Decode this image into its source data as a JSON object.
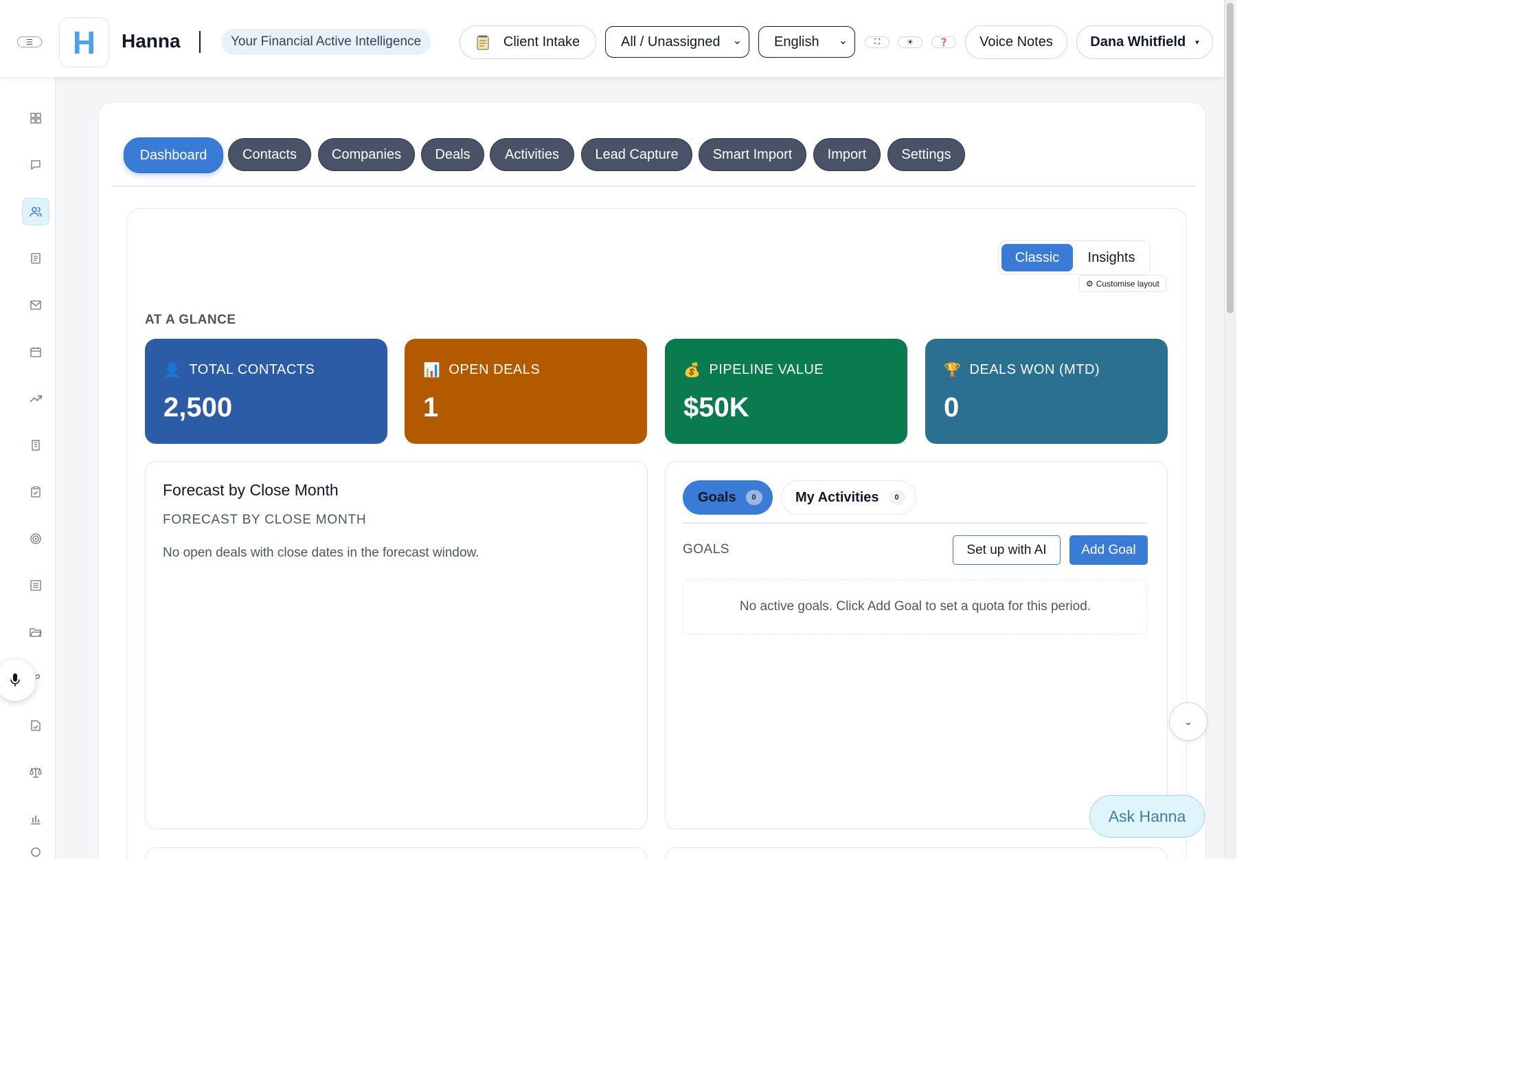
{
  "header": {
    "logo_letter": "H",
    "app_name": "Hanna",
    "tagline": "Your Financial Active Intelligence",
    "client_intake_label": "Client Intake",
    "assignment_filter": "All / Unassigned",
    "language": "English",
    "voice_notes_label": "Voice Notes",
    "user_name": "Dana Whitfield"
  },
  "tabs": [
    {
      "label": "Dashboard",
      "active": true
    },
    {
      "label": "Contacts"
    },
    {
      "label": "Companies"
    },
    {
      "label": "Deals"
    },
    {
      "label": "Activities"
    },
    {
      "label": "Lead Capture"
    },
    {
      "label": "Smart Import"
    },
    {
      "label": "Import"
    },
    {
      "label": "Settings"
    }
  ],
  "view_switch": {
    "classic": "Classic",
    "insights": "Insights",
    "customise": "Customise layout"
  },
  "at_a_glance": {
    "label": "AT A GLANCE",
    "kpis": [
      {
        "label": "TOTAL CONTACTS",
        "value": "2,500",
        "icon": "person-icon",
        "color": "#2d5ca6"
      },
      {
        "label": "OPEN DEALS",
        "value": "1",
        "icon": "bar-chart-icon",
        "color": "#b35a00"
      },
      {
        "label": "PIPELINE VALUE",
        "value": "$50K",
        "icon": "money-bag-icon",
        "color": "#0a7a4f"
      },
      {
        "label": "DEALS WON (MTD)",
        "value": "0",
        "icon": "trophy-icon",
        "color": "#2b6f91"
      }
    ]
  },
  "forecast": {
    "title": "Forecast by Close Month",
    "subtitle": "FORECAST BY CLOSE MONTH",
    "empty": "No open deals with close dates in the forecast window."
  },
  "goals_panel": {
    "goals_tab": "Goals",
    "goals_count": "0",
    "activities_tab": "My Activities",
    "activities_count": "0",
    "section_label": "GOALS",
    "setup_ai": "Set up with AI",
    "add_goal": "Add Goal",
    "empty": "No active goals. Click Add Goal to set a quota for this period."
  },
  "ask_hanna": "Ask Hanna",
  "colors": {
    "accent": "#3a7bd5",
    "tab_inactive": "#4a5268"
  }
}
